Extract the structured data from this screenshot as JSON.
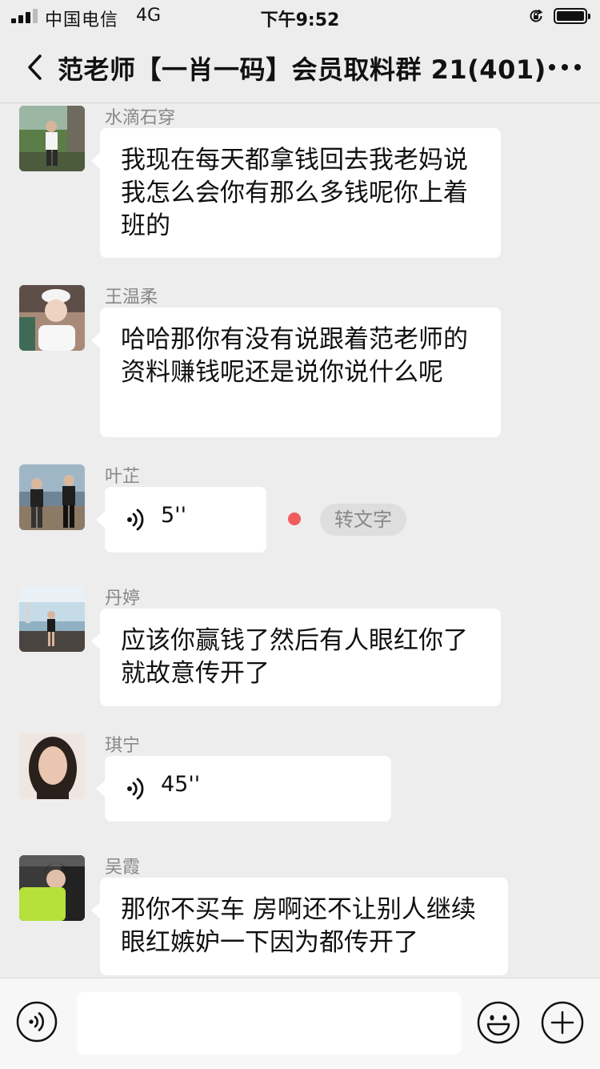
{
  "status_bar": {
    "carrier": "中国电信",
    "network": "4G",
    "time": "下午9:52"
  },
  "nav": {
    "title": "范老师【一肖一码】会员取料群 21(401)"
  },
  "messages": [
    {
      "sender": "水滴石穿",
      "type": "text",
      "text": "我现在每天都拿钱回去我老妈说我怎么会你有那么多钱呢你上着班的"
    },
    {
      "sender": "王温柔",
      "type": "text",
      "text": "哈哈那你有没有说跟着范老师的资料赚钱呢还是说你说什么呢"
    },
    {
      "sender": "叶芷",
      "type": "voice",
      "duration": "5''",
      "action_label": "转文字"
    },
    {
      "sender": "丹婷",
      "type": "text",
      "text": "应该你赢钱了然后有人眼红你了就故意传开了"
    },
    {
      "sender": "琪宁",
      "type": "voice",
      "duration": "45''"
    },
    {
      "sender": "吴霞",
      "type": "text",
      "text": "那你不买车 房啊还不让别人继续眼红嫉妒一下因为都传开了"
    }
  ],
  "colors": {
    "background": "#ededed",
    "bubble": "#ffffff",
    "unread_dot": "#f15b5b",
    "input_bar": "#f7f7f7"
  },
  "icons": {
    "back": "chevron-left-icon",
    "more": "more-dots-icon",
    "voice_input": "voice-input-icon",
    "emoji": "emoji-icon",
    "add": "plus-icon"
  }
}
